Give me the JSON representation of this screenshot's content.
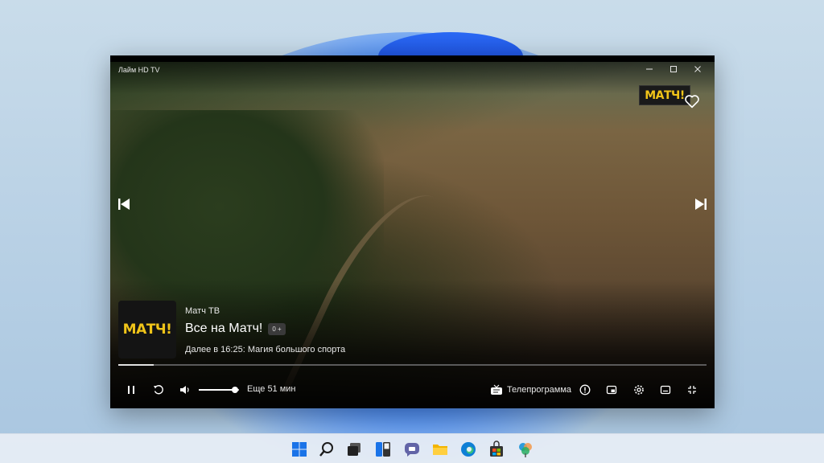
{
  "window": {
    "app_title": "Лайм HD TV",
    "controls": {
      "minimize": "–",
      "maximize": "☐",
      "close": "✕"
    }
  },
  "player": {
    "channel_logo_text": "МАТЧ!",
    "channel_name": "Матч ТВ",
    "show_title": "Все на Матч!",
    "age_rating": "0 +",
    "next_up": "Далее в 16:25: Магия большого спорта",
    "progress_fraction": 0.06,
    "volume_fraction": 0.9,
    "time_left": "Еще 51 мин",
    "tv_guide_label": "Телепрограмма"
  },
  "icons": {
    "favorite": "heart-icon",
    "prev_channel": "skip-previous-icon",
    "next_channel": "skip-next-icon",
    "pause": "pause-icon",
    "replay": "replay-icon",
    "volume": "volume-icon",
    "tv_guide": "tv-icon",
    "info": "info-icon",
    "pip": "picture-in-picture-icon",
    "settings": "gear-icon",
    "subtitles": "subtitles-icon",
    "fullscreen": "fullscreen-icon"
  },
  "taskbar": {
    "apps": [
      "start",
      "search",
      "task-view",
      "widgets",
      "chat",
      "file-explorer",
      "edge",
      "store",
      "photos"
    ]
  },
  "colors": {
    "accent_logo": "#f0c419",
    "windows_blue": "#1d5cf0"
  }
}
